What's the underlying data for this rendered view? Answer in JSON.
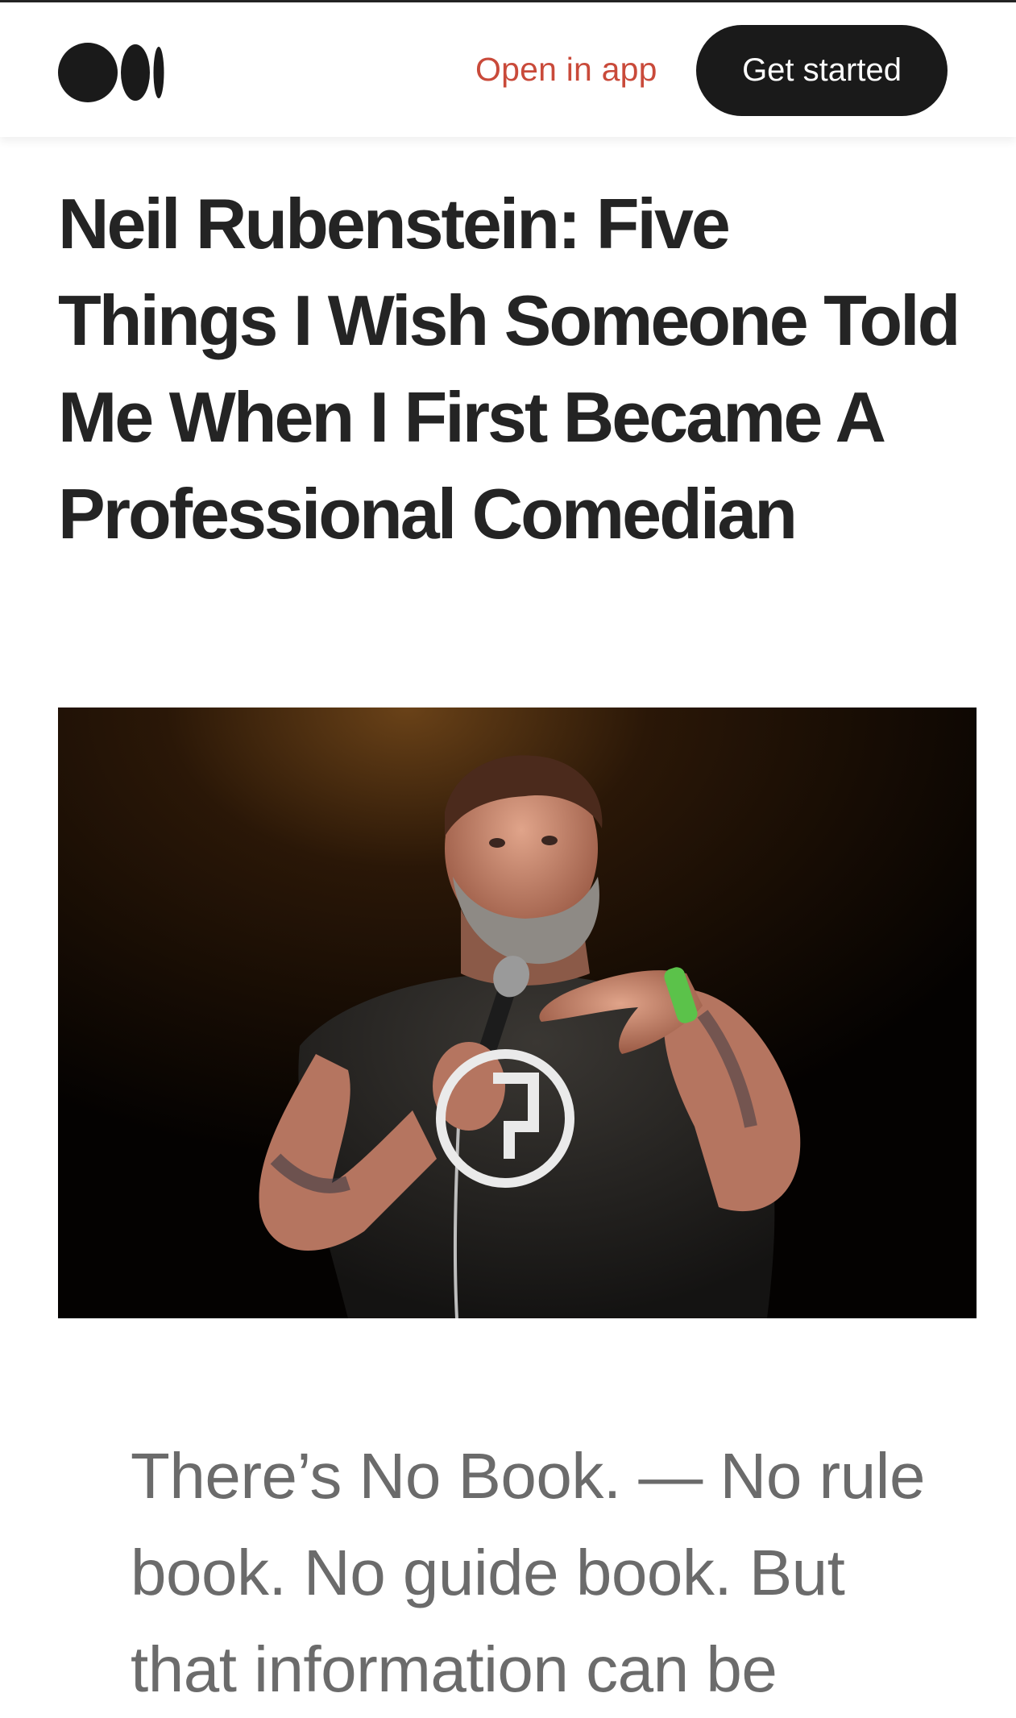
{
  "header": {
    "logo_icon": "medium-logo-icon",
    "open_in_app_label": "Open in app",
    "get_started_label": "Get started",
    "open_in_app_color": "#c94a3a",
    "button_color": "#1a1a1a"
  },
  "article": {
    "title": "Neil Rubenstein: Five Things I Wish Someone Told Me When I First Became A Professional Comedian",
    "hero_image": "comedian-on-stage-photo",
    "lede": "There’s No Book. — No rule book. No guide book. But that information can be"
  }
}
